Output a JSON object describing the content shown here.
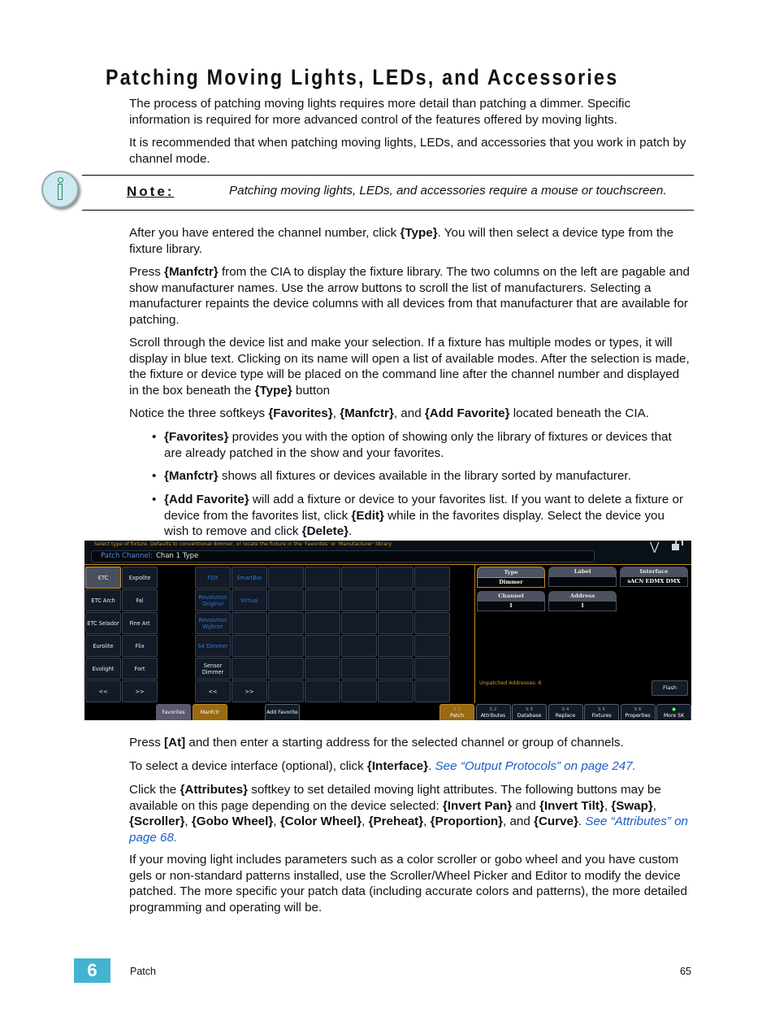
{
  "title": "Patching Moving Lights, LEDs, and Accessories",
  "intro": [
    [
      {
        "t": "The process of patching moving lights requires more detail than patching a dimmer. Specific information is required for more advanced control of the features offered by moving lights."
      }
    ],
    [
      {
        "t": "It is recommended that when patching moving lights, LEDs, and accessories that you work in patch by channel mode."
      }
    ]
  ],
  "note": {
    "icon": "info-icon",
    "label": "Note:",
    "text": "Patching moving lights, LEDs, and accessories require a mouse or touchscreen."
  },
  "body": [
    [
      {
        "t": "After you have entered the channel number, click "
      },
      {
        "t": "{Type}",
        "b": 1
      },
      {
        "t": ". You will then select a device type from the fixture library."
      }
    ],
    [
      {
        "t": "Press "
      },
      {
        "t": "{Manfctr}",
        "b": 1
      },
      {
        "t": " from the CIA to display the fixture library. The two columns on the left are pagable and show manufacturer names. Use the arrow buttons to scroll the list of manufacturers. Selecting a manufacturer repaints the device columns with all devices from that manufacturer that are available for patching."
      }
    ],
    [
      {
        "t": "Scroll through the device list and make your selection. If a fixture has multiple modes or types, it will display in blue text. Clicking on its name will open a list of available modes. After the selection is made, the fixture or device type will be placed on the command line after the channel number and displayed in the box beneath the "
      },
      {
        "t": "{Type}",
        "b": 1
      },
      {
        "t": " button"
      }
    ],
    [
      {
        "t": "Notice the three softkeys "
      },
      {
        "t": "{Favorites}",
        "b": 1
      },
      {
        "t": ", "
      },
      {
        "t": "{Manfctr}",
        "b": 1
      },
      {
        "t": ", and "
      },
      {
        "t": "{Add Favorite}",
        "b": 1
      },
      {
        "t": " located beneath the CIA."
      }
    ]
  ],
  "bullets": [
    [
      {
        "t": "{Favorites}",
        "b": 1
      },
      {
        "t": " provides you with the option of showing only the library of fixtures or devices that are already patched in the show and your favorites."
      }
    ],
    [
      {
        "t": "{Manfctr}",
        "b": 1
      },
      {
        "t": " shows all fixtures or devices available in the library sorted by manufacturer."
      }
    ],
    [
      {
        "t": "{Add Favorite}",
        "b": 1
      },
      {
        "t": " will add a fixture or device to your favorites list. If you want to delete a fixture or device from the favorites list, click "
      },
      {
        "t": "{Edit}",
        "b": 1
      },
      {
        "t": " while in the favorites display. Select the device you wish to remove and click "
      },
      {
        "t": "{Delete}",
        "b": 1
      },
      {
        "t": "."
      }
    ]
  ],
  "screenshot": {
    "hint": "Select type of fixture.  Defaults to conventional dimmer, or locate the fixture in the 'Favorites' or 'Manufacturer' library.",
    "cmd_label": "Patch Channel:",
    "cmd_value": "Chan 1 Type",
    "manufacturers": [
      [
        "ETC",
        "Expolite"
      ],
      [
        "ETC Arch",
        "Fal"
      ],
      [
        "ETC Selador",
        "Fine Art"
      ],
      [
        "Eurolite",
        "Flix"
      ],
      [
        "Evolight",
        "Fort"
      ],
      [
        "<<",
        ">>"
      ]
    ],
    "selected_manufacturer": "ETC",
    "devices": [
      [
        {
          "t": "FDX",
          "blue": 1
        },
        {
          "t": "SmartBar",
          "blue": 1
        },
        {},
        {},
        {},
        {},
        {}
      ],
      [
        {
          "t": "Revolution Original",
          "blue": 1
        },
        {
          "t": "Virtual",
          "blue": 1
        },
        {},
        {},
        {},
        {},
        {}
      ],
      [
        {
          "t": "Revolution Wybron",
          "blue": 1
        },
        {},
        {},
        {},
        {},
        {},
        {}
      ],
      [
        {
          "t": "S4 Dimmer",
          "blue": 1
        },
        {},
        {},
        {},
        {},
        {},
        {}
      ],
      [
        {
          "t": "Sensor Dimmer"
        },
        {},
        {},
        {},
        {},
        {},
        {}
      ],
      [
        {
          "t": "<<"
        },
        {
          "t": ">>"
        },
        {},
        {},
        {},
        {},
        {}
      ]
    ],
    "fields": [
      {
        "label": "Type",
        "value": "Dimmer",
        "active": 1
      },
      {
        "label": "Label",
        "value": ""
      },
      {
        "label": "Interface",
        "value": "sACN EDMX DMX"
      },
      {
        "label": "Channel",
        "value": "1"
      },
      {
        "label": "Address",
        "value": "1"
      }
    ],
    "unpatched": "Unpatched Addresses: 6",
    "flash": "Flash",
    "softkeys_left": [
      "Favorites",
      "Manfctr",
      "Add Favorite"
    ],
    "softkeys": [
      {
        "n": "S 1",
        "l": "Patch"
      },
      {
        "n": "S 2",
        "l": "Attributes"
      },
      {
        "n": "S 3",
        "l": "Database"
      },
      {
        "n": "S 4",
        "l": "Replace"
      },
      {
        "n": "S 5",
        "l": "Fixtures"
      },
      {
        "n": "S 6",
        "l": "Properties"
      },
      {
        "n": "",
        "l": "More SK"
      }
    ],
    "colors": {
      "accent": "#c48a1a",
      "blue_text": "#2d78e0",
      "background": "#000000"
    }
  },
  "after": [
    [
      {
        "t": "Press "
      },
      {
        "t": "[At]",
        "b": 1
      },
      {
        "t": " and then enter a starting address for the selected channel or group of channels."
      }
    ],
    [
      {
        "t": "To select a device interface (optional), click "
      },
      {
        "t": "{Interface}",
        "b": 1
      },
      {
        "t": ". "
      },
      {
        "t": "See “Output Protocols” on page 247.",
        "link": 1
      }
    ],
    [
      {
        "t": "Click the "
      },
      {
        "t": "{Attributes}",
        "b": 1
      },
      {
        "t": " softkey to set detailed moving light attributes. The following buttons may be available on this page depending on the device selected: "
      },
      {
        "t": "{Invert Pan}",
        "b": 1
      },
      {
        "t": " and "
      },
      {
        "t": "{Invert Tilt}",
        "b": 1
      },
      {
        "t": ", "
      },
      {
        "t": "{Swap}",
        "b": 1
      },
      {
        "t": ", "
      },
      {
        "t": "{Scroller}",
        "b": 1
      },
      {
        "t": ", "
      },
      {
        "t": "{Gobo Wheel}",
        "b": 1
      },
      {
        "t": ", "
      },
      {
        "t": "{Color Wheel}",
        "b": 1
      },
      {
        "t": ", "
      },
      {
        "t": "{Preheat}",
        "b": 1
      },
      {
        "t": ", "
      },
      {
        "t": "{Proportion}",
        "b": 1
      },
      {
        "t": ", and "
      },
      {
        "t": "{Curve}",
        "b": 1
      },
      {
        "t": ". "
      },
      {
        "t": "See “Attributes” on page 68.",
        "link": 1
      }
    ],
    [
      {
        "t": "If your moving light includes parameters such as a color scroller or gobo wheel and you have custom gels or non-standard patterns installed, use the Scroller/Wheel Picker and Editor to modify the device patched. The more specific your patch data (including accurate colors and patterns), the more detailed programming and operating will be."
      }
    ]
  ],
  "footer": {
    "chapter": "6",
    "section": "Patch",
    "page": "65"
  }
}
